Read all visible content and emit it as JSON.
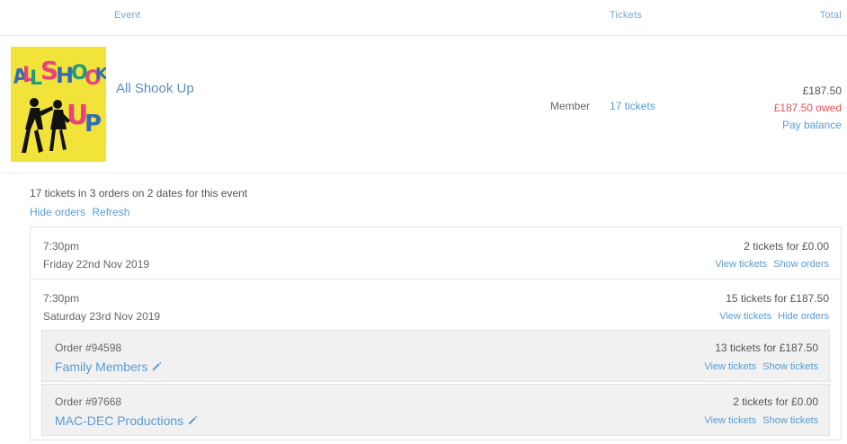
{
  "header": {
    "event_label": "Event",
    "tickets_label": "Tickets",
    "total_label": "Total"
  },
  "event": {
    "poster_icon": "all-shook-up-poster",
    "poster_text_top": "ALL SHOOK",
    "poster_text_bottom": "UP",
    "name": "All Shook Up",
    "member_label": "Member",
    "tickets_link": "17 tickets",
    "total": "£187.50",
    "owed": "£187.50 owed",
    "pay_balance": "Pay balance",
    "owed_color": "#e05454",
    "link_color": "#5b9bd0"
  },
  "summary": {
    "text": "17 tickets in 3 orders on 2 dates for this event",
    "hide_orders": "Hide orders",
    "refresh": "Refresh"
  },
  "dates": [
    {
      "time": "7:30pm",
      "date": "Friday 22nd Nov 2019",
      "tickets_summary": "2 tickets for £0.00",
      "view_tickets": "View tickets",
      "toggle_orders": "Show orders"
    },
    {
      "time": "7:30pm",
      "date": "Saturday 23rd Nov 2019",
      "tickets_summary": "15 tickets for £187.50",
      "view_tickets": "View tickets",
      "toggle_orders": "Hide orders"
    }
  ],
  "orders": [
    {
      "number": "Order #94598",
      "name": "Family Members",
      "tickets_summary": "13 tickets for £187.50",
      "view_tickets": "View tickets",
      "show_tickets": "Show tickets"
    },
    {
      "number": "Order #97668",
      "name": "MAC-DEC Productions",
      "tickets_summary": "2 tickets for £0.00",
      "view_tickets": "View tickets",
      "show_tickets": "Show tickets"
    }
  ]
}
